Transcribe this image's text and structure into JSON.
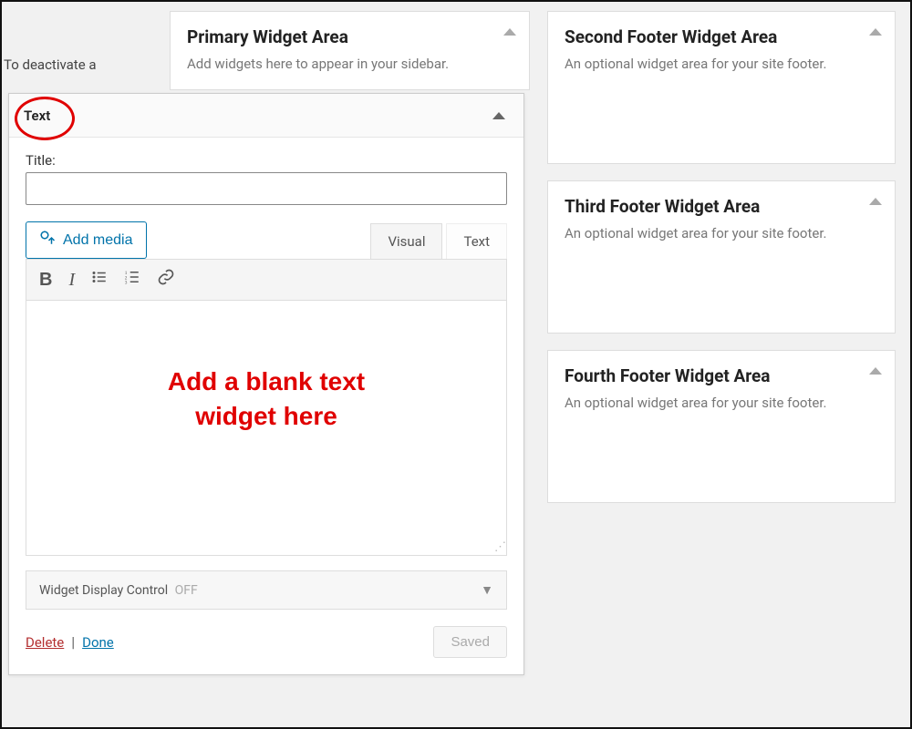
{
  "sidebar_note": "To deactivate a",
  "primary_area": {
    "title": "Primary Widget Area",
    "desc": "Add widgets here to appear in your sidebar."
  },
  "widget": {
    "head_label": "Text",
    "title_label": "Title:",
    "title_value": "",
    "add_media": "Add media",
    "tabs": {
      "visual": "Visual",
      "text": "Text"
    },
    "overlay": "Add a blank text\nwidget here",
    "wdc_label": "Widget Display Control",
    "wdc_state": "OFF",
    "delete": "Delete",
    "done": "Done",
    "saved": "Saved"
  },
  "footer_areas": [
    {
      "title": "Second Footer Widget Area",
      "desc": "An optional widget area for your site footer."
    },
    {
      "title": "Third Footer Widget Area",
      "desc": "An optional widget area for your site footer."
    },
    {
      "title": "Fourth Footer Widget Area",
      "desc": "An optional widget area for your site footer."
    }
  ]
}
